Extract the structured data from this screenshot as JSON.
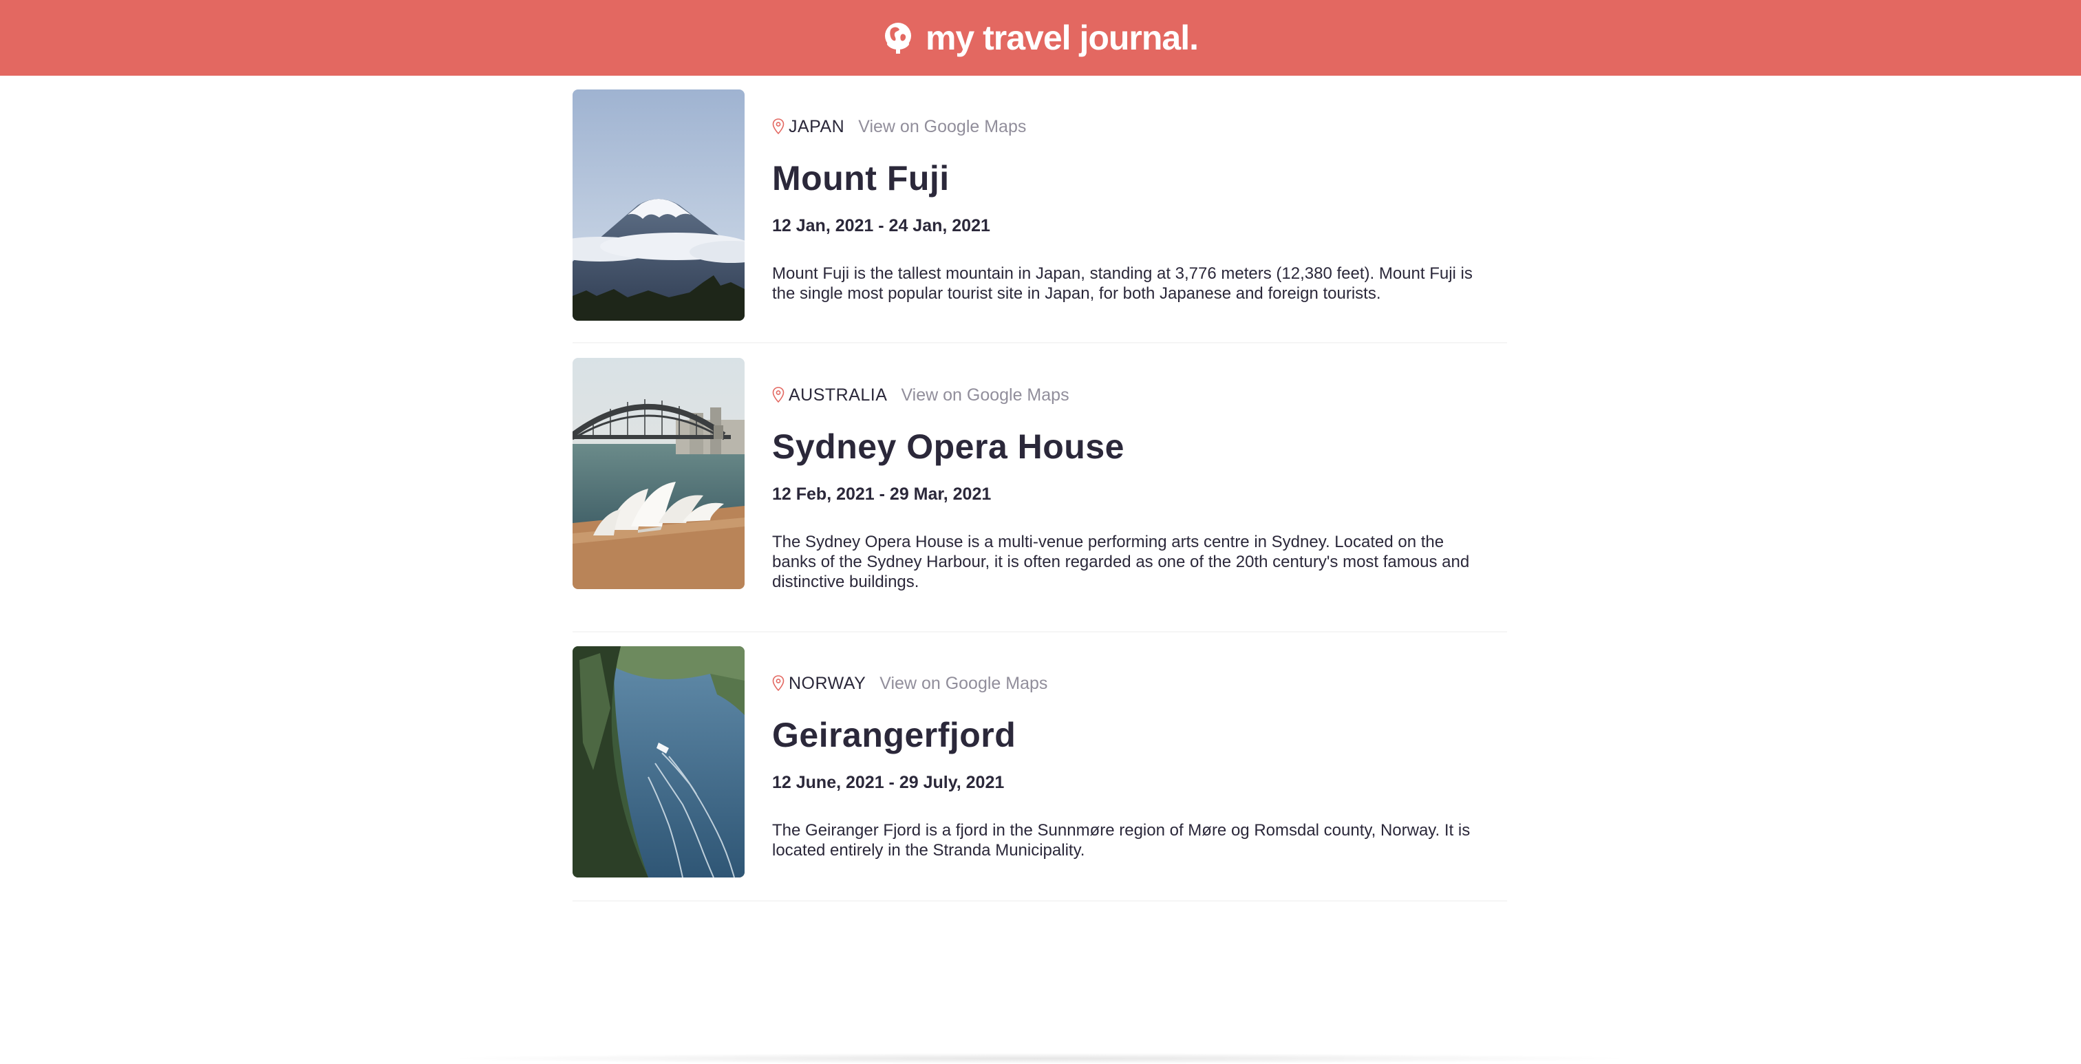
{
  "header": {
    "title": "my travel journal.",
    "logo_icon": "globe-icon",
    "background": "#E36861"
  },
  "entries": [
    {
      "country": "JAPAN",
      "maps_label": "View on Google Maps",
      "title": "Mount Fuji",
      "dates": "12 Jan, 2021 - 24 Jan, 2021",
      "description": "Mount Fuji is the tallest mountain in Japan, standing at 3,776 meters (12,380 feet). Mount Fuji is the single most popular tourist site in Japan, for both Japanese and foreign tourists."
    },
    {
      "country": "AUSTRALIA",
      "maps_label": "View on Google Maps",
      "title": "Sydney Opera House",
      "dates": "12 Feb, 2021 - 29 Mar, 2021",
      "description": "The Sydney Opera House is a multi-venue performing arts centre in Sydney. Located on the banks of the Sydney Harbour, it is often regarded as one of the 20th century's most famous and distinctive buildings."
    },
    {
      "country": "NORWAY",
      "maps_label": "View on Google Maps",
      "title": "Geirangerfjord",
      "dates": "12 June, 2021 - 29 July, 2021",
      "description": "The Geiranger Fjord is a fjord in the Sunnmøre region of Møre og Romsdal county, Norway. It is located entirely in the Stranda Municipality."
    }
  ],
  "colors": {
    "accent": "#E36861",
    "text": "#2B283A",
    "muted": "#918E9B"
  }
}
